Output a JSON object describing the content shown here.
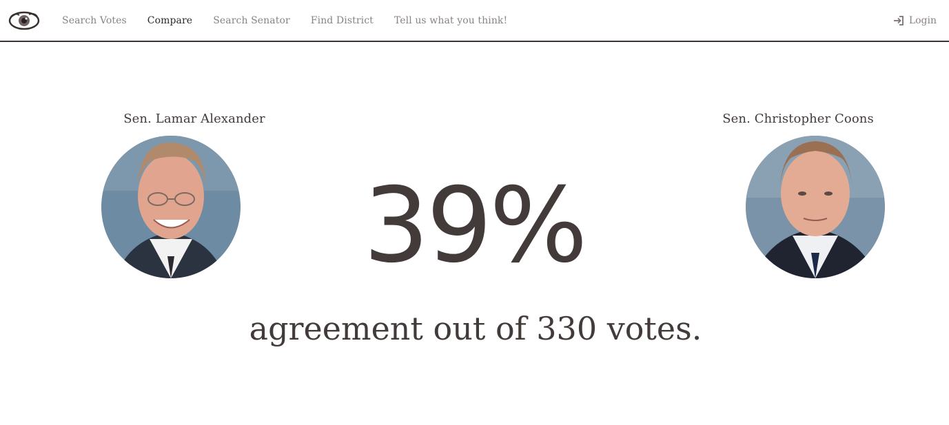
{
  "nav": {
    "logo_icon": "eye-logo-icon",
    "links": [
      {
        "label": "Search Votes",
        "active": false
      },
      {
        "label": "Compare",
        "active": true
      },
      {
        "label": "Search Senator",
        "active": false
      },
      {
        "label": "Find District",
        "active": false
      },
      {
        "label": "Tell us what you think!",
        "active": false
      }
    ],
    "login": {
      "label": "Login",
      "icon": "login-icon"
    }
  },
  "comparison": {
    "senator_left": {
      "name": "Sen. Lamar Alexander",
      "photo_icon": "senator-portrait-icon"
    },
    "senator_right": {
      "name": "Sen. Christopher Coons",
      "photo_icon": "senator-portrait-icon"
    },
    "agreement_percent": "39%",
    "summary": "agreement out of 330 votes."
  },
  "colors": {
    "text": "#433a3a",
    "nav_muted": "#8a8282",
    "nav_active": "#2f2828",
    "divider": "#3d3535",
    "portrait_bg": "#6b8aa3"
  }
}
